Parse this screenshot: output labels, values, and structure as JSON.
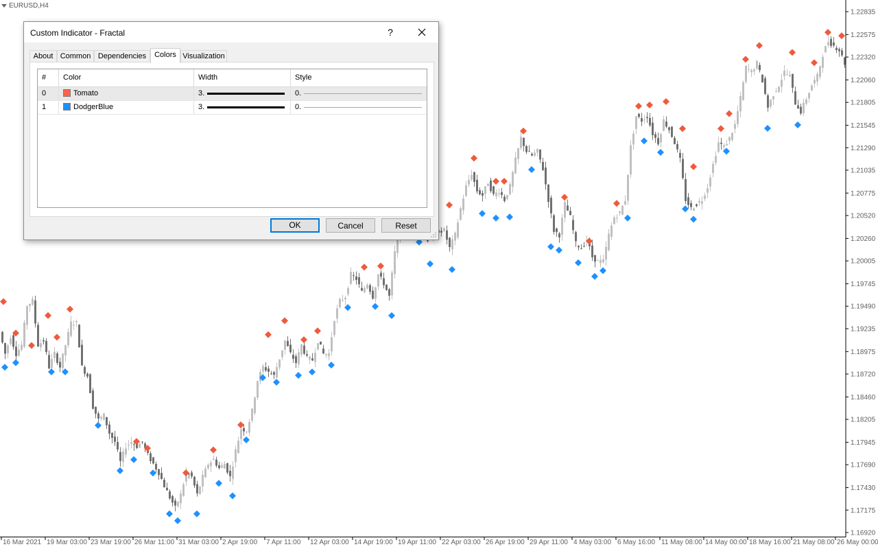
{
  "symbol": "EURUSD,H4",
  "price_axis": [
    "1.22835",
    "1.22575",
    "1.22320",
    "1.22060",
    "1.21805",
    "1.21545",
    "1.21290",
    "1.21035",
    "1.20775",
    "1.20520",
    "1.20260",
    "1.20005",
    "1.19745",
    "1.19490",
    "1.19235",
    "1.18975",
    "1.18720",
    "1.18460",
    "1.18205",
    "1.17945",
    "1.17690",
    "1.17430",
    "1.17175",
    "1.16920"
  ],
  "time_axis": [
    "16 Mar 2021",
    "19 Mar 03:00",
    "23 Mar 19:00",
    "26 Mar 11:00",
    "31 Mar 03:00",
    "2 Apr 19:00",
    "7 Apr 11:00",
    "12 Apr 03:00",
    "14 Apr 19:00",
    "19 Apr 11:00",
    "22 Apr 03:00",
    "26 Apr 19:00",
    "29 Apr 11:00",
    "4 May 03:00",
    "6 May 16:00",
    "11 May 08:00",
    "14 May 00:00",
    "18 May 16:00",
    "21 May 08:00",
    "26 May 00:00"
  ],
  "colors": {
    "bull": "#c0c0c0",
    "bear": "#707070",
    "fractal_up": "#f05a3c",
    "fractal_down": "#1e90ff",
    "axis_text": "#606060"
  },
  "chart_data": {
    "type": "candlestick",
    "symbol": "EURUSD",
    "timeframe": "H4",
    "ylim": [
      1.1692,
      1.22835
    ],
    "price_path": [
      [
        0,
        1.192
      ],
      [
        8,
        1.1895
      ],
      [
        16,
        1.1915
      ],
      [
        24,
        1.1895
      ],
      [
        32,
        1.1905
      ],
      [
        40,
        1.195
      ],
      [
        48,
        1.1955
      ],
      [
        56,
        1.1905
      ],
      [
        64,
        1.191
      ],
      [
        72,
        1.188
      ],
      [
        80,
        1.1895
      ],
      [
        88,
        1.188
      ],
      [
        96,
        1.1905
      ],
      [
        104,
        1.193
      ],
      [
        112,
        1.193
      ],
      [
        120,
        1.188
      ],
      [
        128,
        1.187
      ],
      [
        136,
        1.1835
      ],
      [
        144,
        1.182
      ],
      [
        152,
        1.1825
      ],
      [
        160,
        1.1805
      ],
      [
        168,
        1.1795
      ],
      [
        176,
        1.1772
      ],
      [
        184,
        1.179
      ],
      [
        192,
        1.1795
      ],
      [
        200,
        1.179
      ],
      [
        208,
        1.1795
      ],
      [
        216,
        1.178
      ],
      [
        224,
        1.177
      ],
      [
        232,
        1.176
      ],
      [
        240,
        1.1745
      ],
      [
        248,
        1.1732
      ],
      [
        256,
        1.172
      ],
      [
        264,
        1.1735
      ],
      [
        272,
        1.176
      ],
      [
        280,
        1.1755
      ],
      [
        288,
        1.1735
      ],
      [
        296,
        1.1755
      ],
      [
        304,
        1.177
      ],
      [
        312,
        1.1775
      ],
      [
        320,
        1.1765
      ],
      [
        328,
        1.177
      ],
      [
        336,
        1.1755
      ],
      [
        344,
        1.1785
      ],
      [
        352,
        1.181
      ],
      [
        360,
        1.1808
      ],
      [
        368,
        1.183
      ],
      [
        376,
        1.1865
      ],
      [
        384,
        1.188
      ],
      [
        392,
        1.1875
      ],
      [
        400,
        1.187
      ],
      [
        408,
        1.189
      ],
      [
        416,
        1.191
      ],
      [
        424,
        1.1895
      ],
      [
        432,
        1.1885
      ],
      [
        440,
        1.1905
      ],
      [
        448,
        1.189
      ],
      [
        456,
        1.1888
      ],
      [
        464,
        1.191
      ],
      [
        472,
        1.1895
      ],
      [
        480,
        1.1895
      ],
      [
        488,
        1.1935
      ],
      [
        496,
        1.1955
      ],
      [
        504,
        1.196
      ],
      [
        512,
        1.1985
      ],
      [
        520,
        1.198
      ],
      [
        528,
        1.1965
      ],
      [
        536,
        1.1975
      ],
      [
        544,
        1.196
      ],
      [
        552,
        1.1985
      ],
      [
        560,
        1.1975
      ],
      [
        568,
        1.196
      ],
      [
        576,
        1.201
      ],
      [
        584,
        1.2035
      ],
      [
        592,
        1.205
      ],
      [
        600,
        1.2055
      ],
      [
        608,
        1.2045
      ],
      [
        616,
        1.204
      ],
      [
        624,
        1.2025
      ],
      [
        632,
        1.203
      ],
      [
        640,
        1.2035
      ],
      [
        648,
        1.2035
      ],
      [
        656,
        1.2015
      ],
      [
        664,
        1.203
      ],
      [
        672,
        1.206
      ],
      [
        680,
        1.2085
      ],
      [
        688,
        1.21
      ],
      [
        696,
        1.208
      ],
      [
        704,
        1.2075
      ],
      [
        712,
        1.209
      ],
      [
        720,
        1.2075
      ],
      [
        728,
        1.208
      ],
      [
        736,
        1.207
      ],
      [
        744,
        1.2085
      ],
      [
        752,
        1.2115
      ],
      [
        760,
        1.214
      ],
      [
        768,
        1.2125
      ],
      [
        776,
        1.212
      ],
      [
        784,
        1.2125
      ],
      [
        792,
        1.2105
      ],
      [
        800,
        1.207
      ],
      [
        808,
        1.2035
      ],
      [
        816,
        1.203
      ],
      [
        824,
        1.2065
      ],
      [
        832,
        1.205
      ],
      [
        840,
        1.202
      ],
      [
        848,
        1.2015
      ],
      [
        856,
        1.2025
      ],
      [
        864,
        1.2005
      ],
      [
        872,
        1.2
      ],
      [
        880,
        1.2
      ],
      [
        888,
        1.203
      ],
      [
        896,
        1.205
      ],
      [
        904,
        1.2055
      ],
      [
        912,
        1.207
      ],
      [
        920,
        1.213
      ],
      [
        928,
        1.2165
      ],
      [
        936,
        1.216
      ],
      [
        944,
        1.2165
      ],
      [
        952,
        1.2145
      ],
      [
        960,
        1.2135
      ],
      [
        968,
        1.216
      ],
      [
        976,
        1.215
      ],
      [
        984,
        1.2135
      ],
      [
        992,
        1.2115
      ],
      [
        1000,
        1.207
      ],
      [
        1008,
        1.206
      ],
      [
        1016,
        1.2065
      ],
      [
        1024,
        1.207
      ],
      [
        1032,
        1.2085
      ],
      [
        1040,
        1.211
      ],
      [
        1048,
        1.2135
      ],
      [
        1056,
        1.213
      ],
      [
        1064,
        1.214
      ],
      [
        1072,
        1.2155
      ],
      [
        1080,
        1.2185
      ],
      [
        1088,
        1.222
      ],
      [
        1096,
        1.2215
      ],
      [
        1104,
        1.2225
      ],
      [
        1112,
        1.2205
      ],
      [
        1120,
        1.2175
      ],
      [
        1128,
        1.219
      ],
      [
        1136,
        1.22
      ],
      [
        1144,
        1.2215
      ],
      [
        1152,
        1.221
      ],
      [
        1160,
        1.218
      ],
      [
        1168,
        1.217
      ],
      [
        1176,
        1.2185
      ],
      [
        1184,
        1.22
      ],
      [
        1192,
        1.221
      ],
      [
        1200,
        1.2235
      ],
      [
        1208,
        1.225
      ],
      [
        1216,
        1.2245
      ],
      [
        1224,
        1.224
      ],
      [
        1232,
        1.2225
      ]
    ],
    "fractals_up": [
      [
        5,
        1.19542
      ],
      [
        23,
        1.19185
      ],
      [
        46,
        1.19045
      ],
      [
        70,
        1.19385
      ],
      [
        83,
        1.19138
      ],
      [
        102,
        1.19457
      ],
      [
        199,
        1.17955
      ],
      [
        215,
        1.17878
      ],
      [
        271,
        1.17598
      ],
      [
        311,
        1.17858
      ],
      [
        351,
        1.18143
      ],
      [
        391,
        1.19167
      ],
      [
        415,
        1.19325
      ],
      [
        443,
        1.1911
      ],
      [
        463,
        1.1921
      ],
      [
        531,
        1.19934
      ],
      [
        555,
        1.19947
      ],
      [
        655,
        1.20639
      ],
      [
        691,
        1.21171
      ],
      [
        723,
        1.20909
      ],
      [
        735,
        1.20909
      ],
      [
        763,
        1.2148
      ],
      [
        823,
        1.20728
      ],
      [
        859,
        1.20229
      ],
      [
        899,
        1.20658
      ],
      [
        931,
        1.21762
      ],
      [
        947,
        1.21775
      ],
      [
        971,
        1.21814
      ],
      [
        995,
        1.21507
      ],
      [
        1011,
        1.21075
      ],
      [
        1051,
        1.21507
      ],
      [
        1063,
        1.21677
      ],
      [
        1087,
        1.22294
      ],
      [
        1107,
        1.2245
      ],
      [
        1155,
        1.22372
      ],
      [
        1187,
        1.22255
      ],
      [
        1207,
        1.226
      ],
      [
        1227,
        1.22561
      ]
    ],
    "fractals_down": [
      [
        7,
        1.18797
      ],
      [
        23,
        1.18849
      ],
      [
        75,
        1.18745
      ],
      [
        95,
        1.18745
      ],
      [
        143,
        1.18137
      ],
      [
        175,
        1.17622
      ],
      [
        195,
        1.17748
      ],
      [
        223,
        1.17596
      ],
      [
        247,
        1.17132
      ],
      [
        259,
        1.17054
      ],
      [
        287,
        1.17132
      ],
      [
        319,
        1.17479
      ],
      [
        339,
        1.17337
      ],
      [
        359,
        1.17972
      ],
      [
        383,
        1.18679
      ],
      [
        403,
        1.18627
      ],
      [
        435,
        1.18705
      ],
      [
        455,
        1.18744
      ],
      [
        483,
        1.18822
      ],
      [
        507,
        1.19475
      ],
      [
        547,
        1.19488
      ],
      [
        571,
        1.19384
      ],
      [
        611,
        1.20218
      ],
      [
        627,
        1.19971
      ],
      [
        659,
        1.19907
      ],
      [
        703,
        1.20543
      ],
      [
        723,
        1.20491
      ],
      [
        743,
        1.20504
      ],
      [
        775,
        1.21042
      ],
      [
        803,
        1.20166
      ],
      [
        815,
        1.20127
      ],
      [
        843,
        1.19984
      ],
      [
        867,
        1.19829
      ],
      [
        879,
        1.19894
      ],
      [
        915,
        1.20491
      ],
      [
        939,
        1.21367
      ],
      [
        963,
        1.21237
      ],
      [
        999,
        1.20595
      ],
      [
        1011,
        1.20478
      ],
      [
        1059,
        1.2125
      ],
      [
        1119,
        1.2151
      ],
      [
        1163,
        1.21549
      ]
    ]
  },
  "dialog": {
    "title": "Custom Indicator - Fractal",
    "help": "?",
    "tabs": [
      "About",
      "Common",
      "Dependencies",
      "Colors",
      "Visualization"
    ],
    "active_tab": "Colors",
    "table": {
      "headers": [
        "#",
        "Color",
        "Width",
        "Style"
      ],
      "rows": [
        {
          "index": "0",
          "color_name": "Tomato",
          "color_hex": "#ff6347",
          "width": "3.",
          "style": "0."
        },
        {
          "index": "1",
          "color_name": "DodgerBlue",
          "color_hex": "#1e90ff",
          "width": "3.",
          "style": "0."
        }
      ]
    },
    "buttons": {
      "ok": "OK",
      "cancel": "Cancel",
      "reset": "Reset"
    }
  }
}
